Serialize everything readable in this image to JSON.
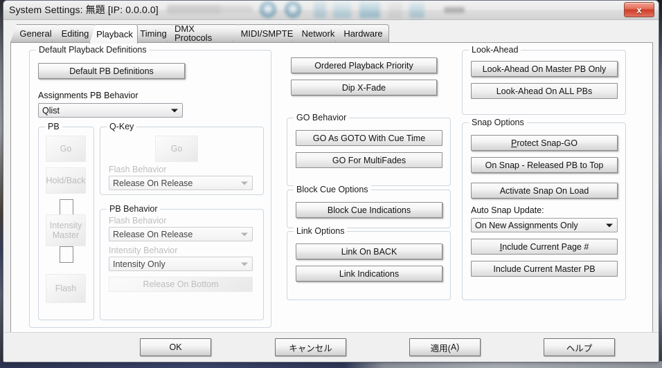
{
  "window": {
    "title": "System Settings: 無題  [IP: 0.0.0.0]",
    "close_label": "x"
  },
  "tabs": [
    {
      "label": "General",
      "active": false
    },
    {
      "label": "Editing",
      "active": false
    },
    {
      "label": "Playback",
      "active": true
    },
    {
      "label": "Timing",
      "active": false
    },
    {
      "label": "DMX Protocols",
      "active": false
    },
    {
      "label": "MIDI/SMPTE",
      "active": false
    },
    {
      "label": "Network",
      "active": false
    },
    {
      "label": "Hardware",
      "active": false
    }
  ],
  "default_playback": {
    "group_title": "Default Playback Definitions",
    "definitions_button": "Default PB Definitions",
    "assignments_label": "Assignments PB Behavior",
    "assignments_value": "Qlist"
  },
  "pb_group": {
    "title": "PB",
    "go": "Go",
    "hold_back": "Hold/Back",
    "intensity_master_line1": "Intensity",
    "intensity_master_line2": "Master",
    "flash": "Flash"
  },
  "qkey_group": {
    "title": "Q-Key",
    "go": "Go",
    "flash_behavior_label": "Flash Behavior",
    "flash_behavior_value": "Release On Release"
  },
  "pb_behavior_group": {
    "title": "PB Behavior",
    "flash_behavior_label": "Flash Behavior",
    "flash_behavior_value": "Release On Release",
    "intensity_behavior_label": "Intensity Behavior",
    "intensity_behavior_value": "Intensity Only",
    "release_on_bottom": "Release On Bottom"
  },
  "middle": {
    "ordered_playback_priority": "Ordered Playback Priority",
    "dip_x_fade": "Dip X-Fade",
    "go_behavior": {
      "title": "GO Behavior",
      "go_as_goto": "GO As GOTO With Cue Time",
      "go_for_multifades": "GO For MultiFades"
    },
    "block_cue_options": {
      "title": "Block Cue Options",
      "block_cue_indications": "Block Cue Indications"
    },
    "link_options": {
      "title": "Link Options",
      "link_on_back": "Link On BACK",
      "link_indications": "Link Indications"
    }
  },
  "right": {
    "look_ahead": {
      "title": "Look-Ahead",
      "master_pb_only": "Look-Ahead On Master PB Only",
      "all_pbs": "Look-Ahead On ALL PBs"
    },
    "snap_options": {
      "title": "Snap Options",
      "protect_snap_go_accel": "P",
      "protect_snap_go_rest": "rotect Snap-GO",
      "on_snap_released": "On Snap - Released PB to Top",
      "activate_snap_on_load": "Activate Snap On Load",
      "auto_snap_update_label": "Auto Snap Update:",
      "auto_snap_update_value": "On New Assignments Only",
      "include_page_accel": "I",
      "include_page_rest": "nclude Current Page #",
      "include_master_pb": "Include Current Master PB"
    }
  },
  "footer": {
    "ok": "OK",
    "cancel": "キャンセル",
    "apply_pre": "適用(",
    "apply_accel": "A",
    "apply_post": ")",
    "help": "ヘルプ"
  }
}
